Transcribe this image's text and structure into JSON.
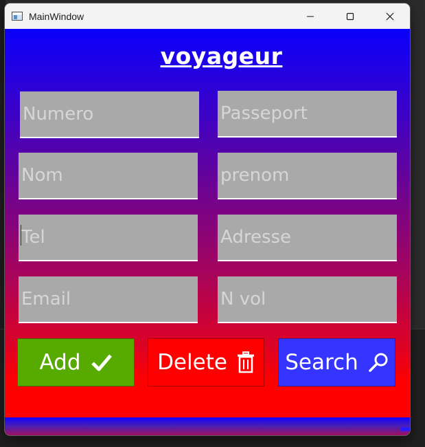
{
  "window": {
    "title": "MainWindow",
    "controls": [
      "minimize",
      "maximize",
      "close"
    ]
  },
  "form": {
    "heading": "voyageur",
    "fields": {
      "numero": {
        "placeholder": "Numero",
        "value": ""
      },
      "passeport": {
        "placeholder": "Passeport",
        "value": ""
      },
      "nom": {
        "placeholder": "Nom",
        "value": ""
      },
      "prenom": {
        "placeholder": "prenom",
        "value": ""
      },
      "tel": {
        "placeholder": "Tel",
        "value": ""
      },
      "adresse": {
        "placeholder": "Adresse",
        "value": ""
      },
      "email": {
        "placeholder": "Email",
        "value": ""
      },
      "nvol": {
        "placeholder": "N vol",
        "value": ""
      }
    },
    "buttons": {
      "add": {
        "label": "Add",
        "icon": "check-icon",
        "color": "#57aa00"
      },
      "delete": {
        "label": "Delete",
        "icon": "trash-icon",
        "color": "#ff0000"
      },
      "search": {
        "label": "Search",
        "icon": "search-icon",
        "color": "#3535ff"
      }
    }
  },
  "colors": {
    "gradient_top": "#0a00fc",
    "gradient_bottom": "#ff0000",
    "field_background": "#a9a9a9"
  }
}
